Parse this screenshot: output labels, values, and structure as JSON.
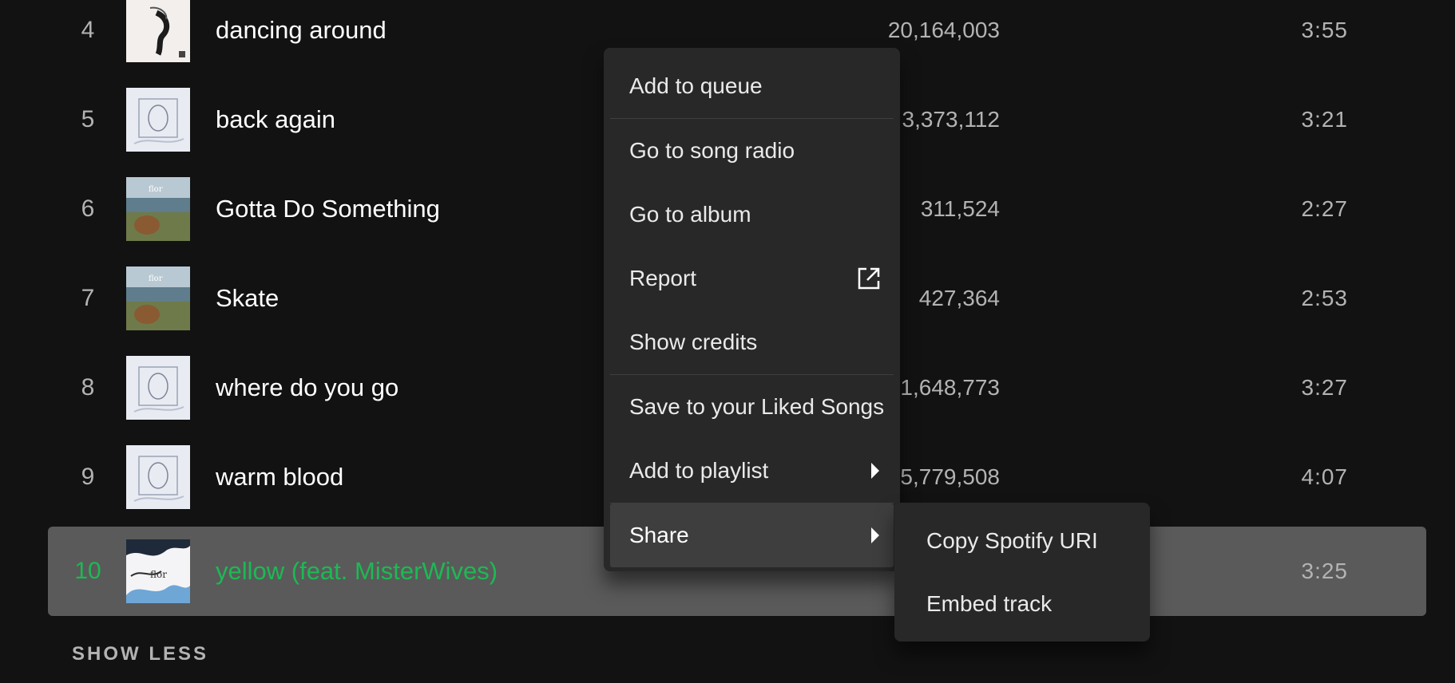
{
  "tracks": [
    {
      "number": "4",
      "title": "dancing around",
      "plays": "20,164,003",
      "duration": "3:55",
      "art": "white-figure-art"
    },
    {
      "number": "5",
      "title": "back again",
      "plays": "3,373,112",
      "duration": "3:21",
      "art": "sketch-art"
    },
    {
      "number": "6",
      "title": "Gotta Do Something",
      "plays": "311,524",
      "duration": "2:27",
      "art": "landscape-art"
    },
    {
      "number": "7",
      "title": "Skate",
      "plays": "427,364",
      "duration": "2:53",
      "art": "landscape-art"
    },
    {
      "number": "8",
      "title": "where do you go",
      "plays": "1,648,773",
      "duration": "3:27",
      "art": "sketch-art"
    },
    {
      "number": "9",
      "title": "warm blood",
      "plays": "5,779,508",
      "duration": "4:07",
      "art": "sketch-art"
    },
    {
      "number": "10",
      "title": "yellow (feat. MisterWives)",
      "plays": "",
      "duration": "3:25",
      "art": "flor-art",
      "active": true
    }
  ],
  "show_less_label": "SHOW LESS",
  "context_menu": {
    "items": [
      {
        "label": "Add to queue"
      },
      {
        "label": "Go to song radio"
      },
      {
        "label": "Go to album"
      },
      {
        "label": "Report",
        "icon": "external-link-icon"
      },
      {
        "label": "Show credits"
      },
      {
        "label": "Save to your Liked Songs"
      },
      {
        "label": "Add to playlist",
        "icon": "caret-right-icon"
      },
      {
        "label": "Share",
        "icon": "caret-right-icon",
        "hovered": true
      }
    ]
  },
  "share_submenu": {
    "items": [
      {
        "label": "Copy Spotify URI"
      },
      {
        "label": "Embed track"
      }
    ]
  },
  "colors": {
    "background": "#121212",
    "menu_background": "#282828",
    "active_row": "#5a5a5a",
    "accent_green": "#1db954",
    "secondary_text": "#b3b3b3"
  }
}
